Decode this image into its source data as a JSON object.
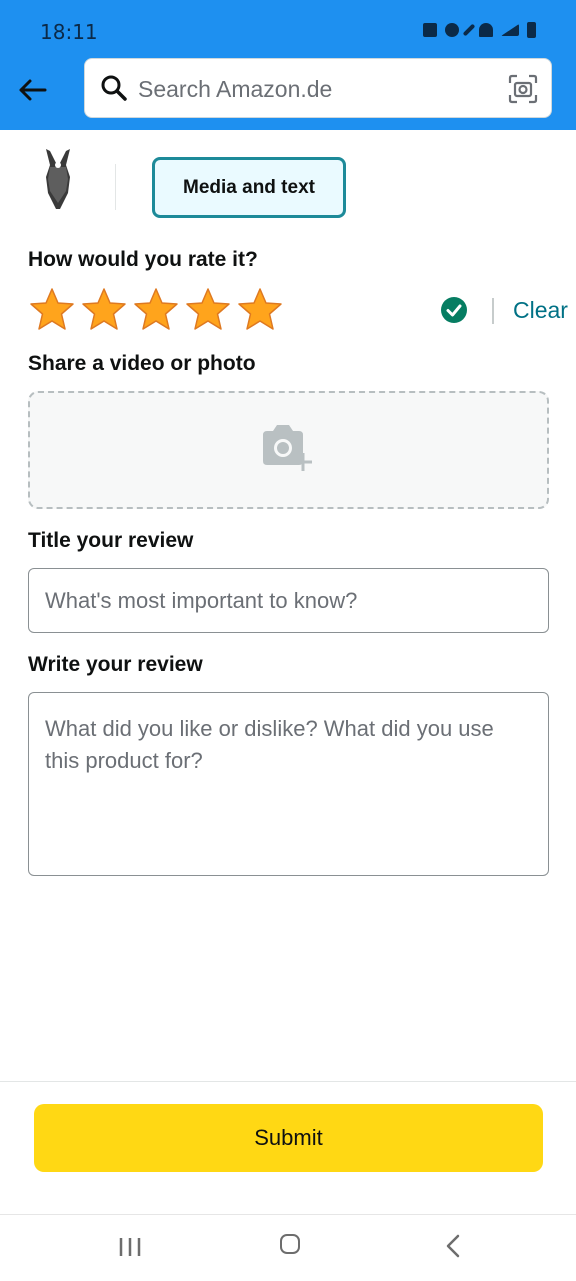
{
  "status": {
    "time": "18:11"
  },
  "search": {
    "placeholder": "Search Amazon.de"
  },
  "tabs": {
    "media_text": "Media and text"
  },
  "rating": {
    "question": "How would you rate it?",
    "value": 5,
    "max": 5,
    "clear_label": "Clear"
  },
  "media": {
    "question": "Share a video or photo"
  },
  "title_field": {
    "label": "Title your review",
    "placeholder": "What's most important to know?"
  },
  "review_field": {
    "label": "Write your review",
    "placeholder": "What did you like or dislike? What did you use this product for?"
  },
  "submit": {
    "label": "Submit"
  },
  "colors": {
    "header": "#1e90f0",
    "accent_teal": "#1d8a99",
    "link": "#007185",
    "star": "#ffa41c",
    "submit": "#ffd814",
    "check": "#067d62"
  },
  "icons": [
    "back-arrow-icon",
    "search-icon",
    "camera-scan-icon",
    "check-icon",
    "camera-add-icon",
    "nav-recent-icon",
    "nav-home-icon",
    "nav-back-icon"
  ]
}
